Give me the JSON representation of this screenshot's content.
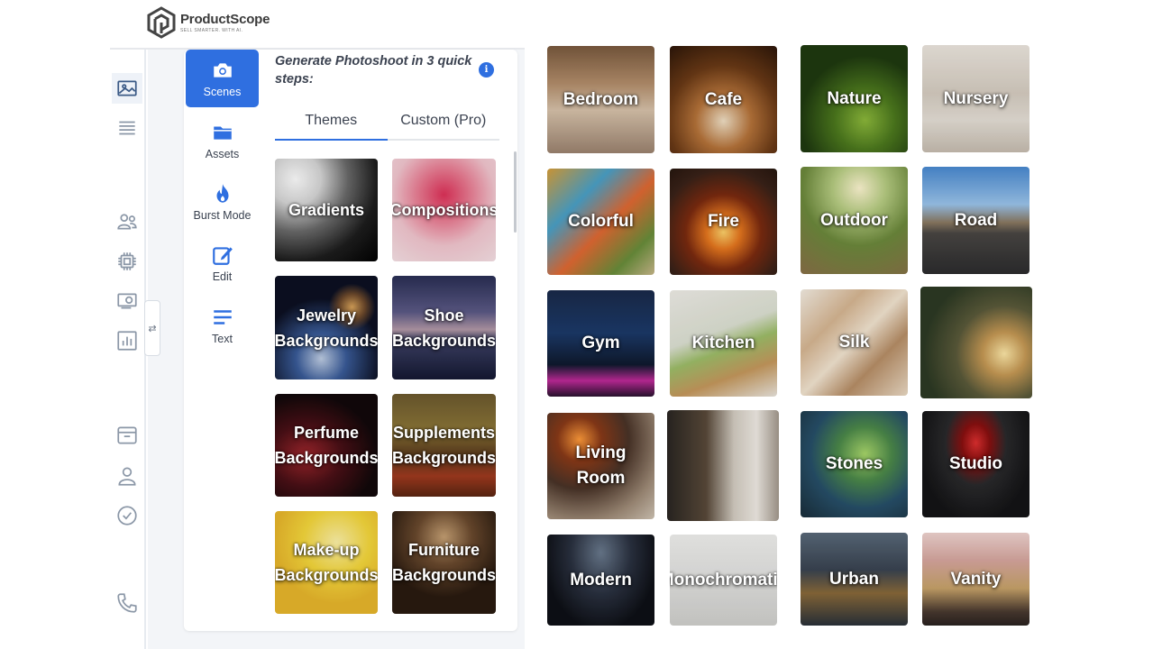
{
  "brand": {
    "name": "ProductScope",
    "tagline": "SELL SMARTER. WITH AI."
  },
  "rail": {
    "icons": [
      "image-icon",
      "list-icon",
      "users-icon",
      "chip-icon",
      "money-icon",
      "chart-icon",
      "inbox-icon",
      "user-icon",
      "check-circle-icon",
      "phone-icon"
    ],
    "collapse_glyph": "⇄"
  },
  "tools": [
    {
      "label": "Scenes",
      "icon": "camera-icon",
      "active": true
    },
    {
      "label": "Assets",
      "icon": "folder-icon",
      "active": false
    },
    {
      "label": "Burst Mode",
      "icon": "fire-icon",
      "active": false
    },
    {
      "label": "Edit",
      "icon": "edit-icon",
      "active": false
    },
    {
      "label": "Text",
      "icon": "text-icon",
      "active": false
    }
  ],
  "panel": {
    "title": "Generate Photoshoot in 3 quick steps:",
    "info_glyph": "i",
    "tabs": [
      {
        "label": "Themes",
        "active": true
      },
      {
        "label": "Custom (Pro)",
        "active": false
      }
    ],
    "themes": [
      {
        "label": "Gradients"
      },
      {
        "label": "Compositions"
      },
      {
        "label": "Jewelry Backgrounds"
      },
      {
        "label": "Shoe Backgrounds"
      },
      {
        "label": "Perfume Backgrounds"
      },
      {
        "label": "Supplements Backgrounds"
      },
      {
        "label": "Make-up Backgrounds"
      },
      {
        "label": "Furniture Backgrounds"
      }
    ]
  },
  "scenes": [
    {
      "label": "Bedroom"
    },
    {
      "label": "Cafe"
    },
    {
      "label": "Nature"
    },
    {
      "label": "Nursery"
    },
    {
      "label": "Colorful"
    },
    {
      "label": "Fire"
    },
    {
      "label": "Outdoor"
    },
    {
      "label": "Road"
    },
    {
      "label": "Gym"
    },
    {
      "label": "Kitchen"
    },
    {
      "label": "Silk"
    },
    {
      "label": ""
    },
    {
      "label": "Living Room"
    },
    {
      "label": ""
    },
    {
      "label": "Stones"
    },
    {
      "label": "Studio"
    },
    {
      "label": "Modern"
    },
    {
      "label": "Monochromatic"
    },
    {
      "label": "Urban"
    },
    {
      "label": "Vanity"
    }
  ],
  "colors": {
    "accent": "#2f6fe0",
    "rail_icon": "#8b97a7",
    "panel_bg": "#f3f5f8"
  }
}
